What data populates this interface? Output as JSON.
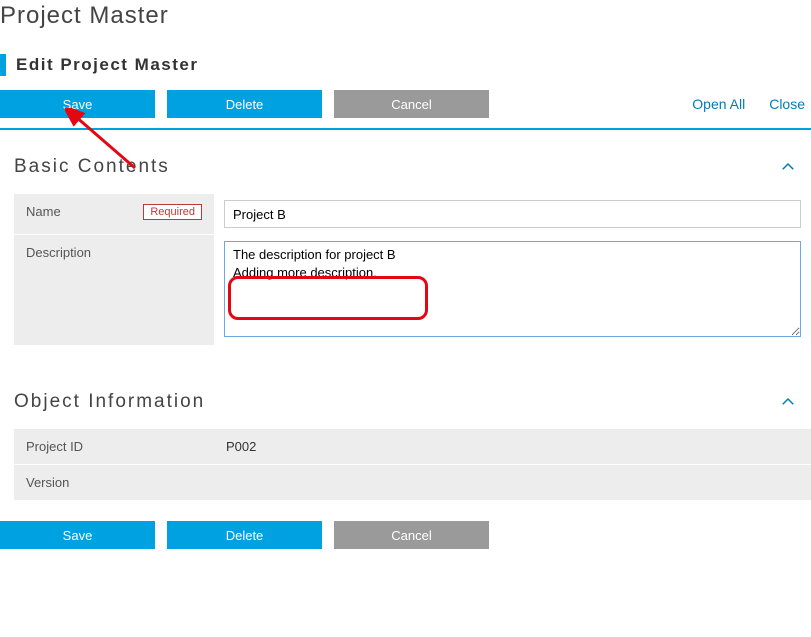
{
  "header": {
    "page_title": "Project Master",
    "subtitle": "Edit Project Master"
  },
  "toolbar": {
    "save_label": "Save",
    "delete_label": "Delete",
    "cancel_label": "Cancel",
    "open_all_label": "Open All",
    "close_label": "Close"
  },
  "sections": {
    "basic": {
      "title": "Basic Contents",
      "name_label": "Name",
      "required_badge": "Required",
      "name_value": "Project B",
      "description_label": "Description",
      "description_value": "The description for project B\nAdding more description."
    },
    "object": {
      "title": "Object Information",
      "project_id_label": "Project ID",
      "project_id_value": "P002",
      "version_label": "Version",
      "version_value": ""
    }
  },
  "footer": {
    "save_label": "Save",
    "delete_label": "Delete",
    "cancel_label": "Cancel"
  }
}
